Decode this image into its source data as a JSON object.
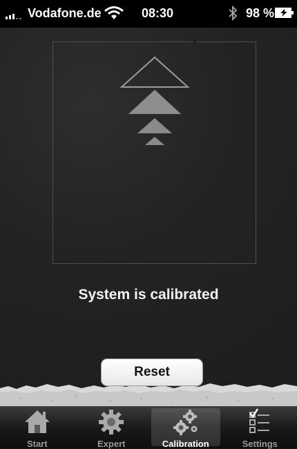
{
  "status_bar": {
    "carrier": "Vodafone.de",
    "time": "08:30",
    "battery": "98 %",
    "icons": [
      "signal-icon",
      "wifi-icon",
      "bluetooth-icon",
      "battery-charging-icon"
    ]
  },
  "calibration": {
    "status_text": "System is calibrated",
    "reset_label": "Reset",
    "indicator_icon": "up-arrows-icon"
  },
  "tabs": [
    {
      "label": "Start",
      "icon": "home-icon",
      "active": false
    },
    {
      "label": "Expert",
      "icon": "gear-icon",
      "active": false
    },
    {
      "label": "Calibration",
      "icon": "gears-icon",
      "active": true
    },
    {
      "label": "Settings",
      "icon": "checklist-icon",
      "active": false
    }
  ],
  "colors": {
    "background": "#1f1f1f",
    "tab_bar": "#1b1b1b",
    "button": "#ffffff"
  }
}
